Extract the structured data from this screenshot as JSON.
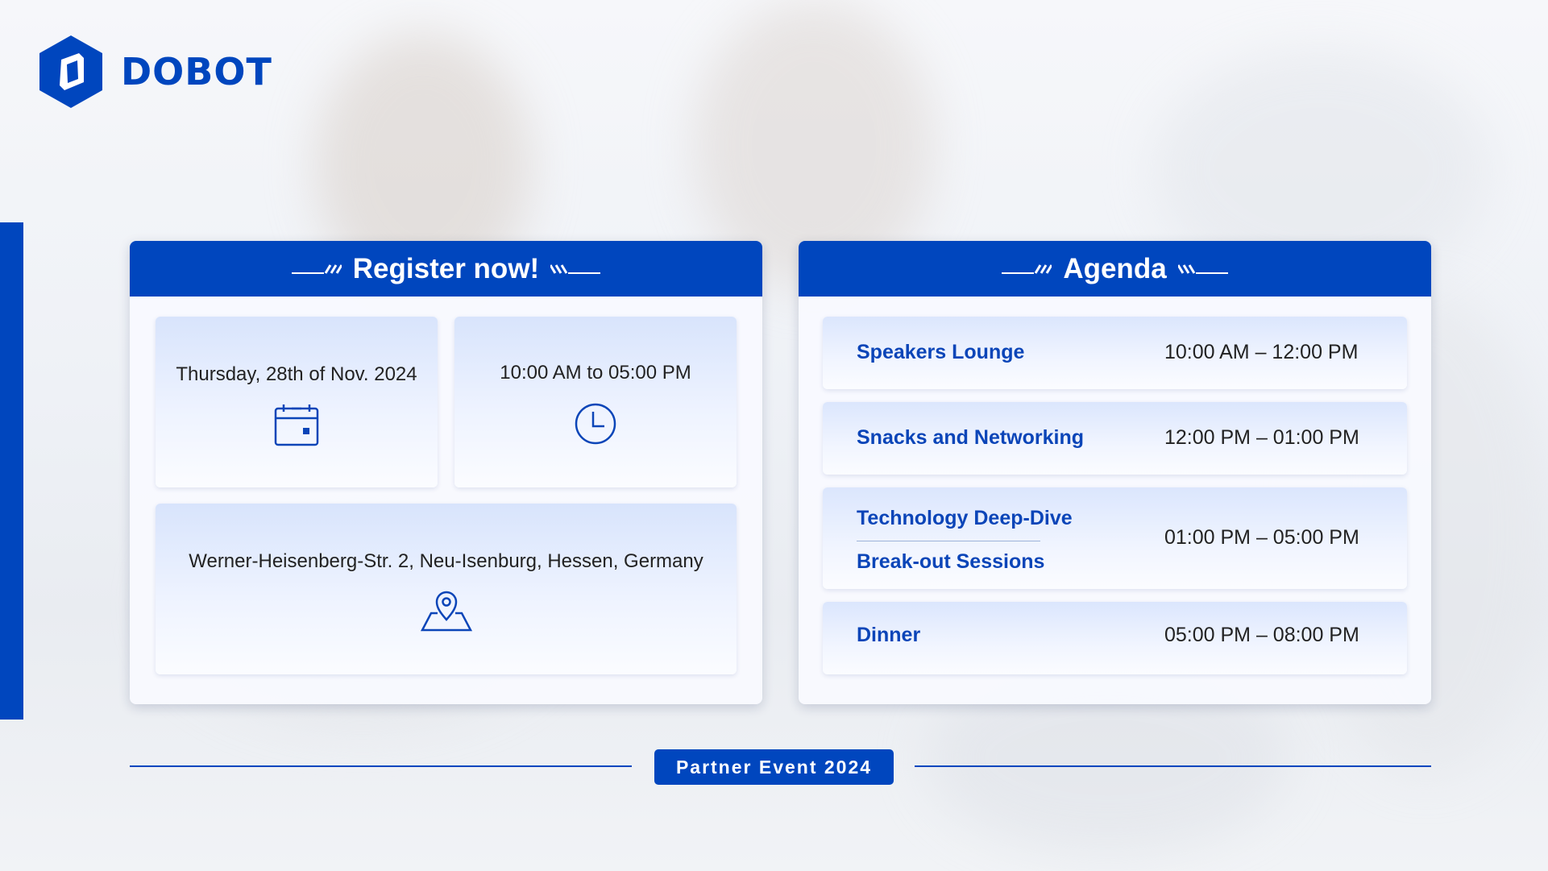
{
  "brand": {
    "name": "DOBOT",
    "color": "#0046be"
  },
  "register": {
    "title": "Register now!",
    "date": "Thursday, 28th of Nov. 2024",
    "date_icon": "calendar-icon",
    "time": "10:00 AM to 05:00 PM",
    "time_icon": "clock-icon",
    "address": "Werner-Heisenberg-Str. 2, Neu-Isenburg, Hessen, Germany",
    "address_icon": "map-pin-icon"
  },
  "agenda": {
    "title": "Agenda",
    "items": [
      {
        "title": "Speakers Lounge",
        "time": "10:00 AM – 12:00 PM"
      },
      {
        "title": "Snacks and Networking",
        "time": "12:00 PM – 01:00 PM"
      },
      {
        "title": "Technology Deep-Dive",
        "subtitle": "Break-out Sessions",
        "time": "01:00 PM – 05:00 PM"
      },
      {
        "title": "Dinner",
        "time": "05:00 PM – 08:00 PM"
      }
    ]
  },
  "footer": {
    "badge": "Partner Event 2024"
  }
}
